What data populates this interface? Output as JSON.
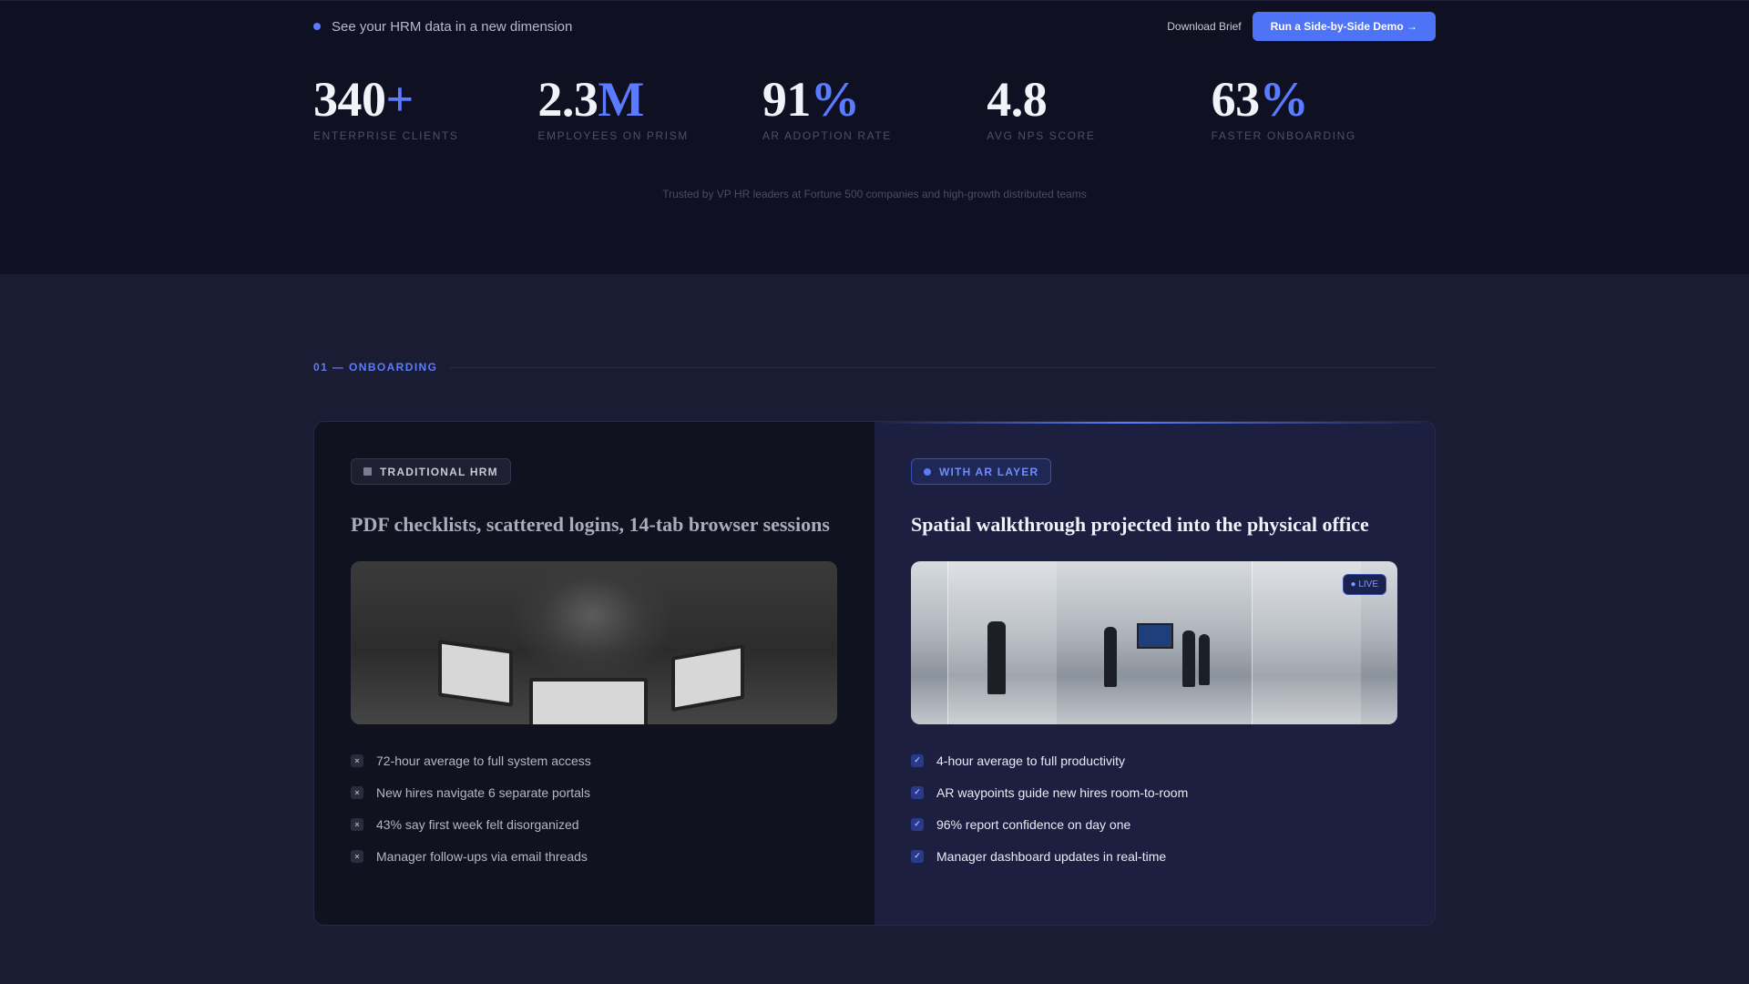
{
  "topbar": {
    "announcement": "See your HRM data in a new dimension",
    "download_label": "Download Brief",
    "demo_label": "Run a Side-by-Side Demo →"
  },
  "stats": [
    {
      "value": "340",
      "suffix": "+",
      "label": "ENTERPRISE CLIENTS"
    },
    {
      "value": "2.3",
      "suffix": "M",
      "label": "EMPLOYEES ON PRISM"
    },
    {
      "value": "91",
      "suffix": "%",
      "label": "AR ADOPTION RATE"
    },
    {
      "value": "4.8",
      "suffix": "",
      "label": "AVG NPS SCORE"
    },
    {
      "value": "63",
      "suffix": "%",
      "label": "FASTER ONBOARDING"
    }
  ],
  "trusted_text": "Trusted by VP HR leaders at Fortune 500 companies and high-growth distributed teams",
  "section": {
    "eyebrow": "01 — ONBOARDING"
  },
  "traditional": {
    "badge": "TRADITIONAL HRM",
    "title": "PDF checklists, scattered logins, 14-tab browser sessions",
    "items": [
      "72-hour average to full system access",
      "New hires navigate 6 separate portals",
      "43% say first week felt disorganized",
      "Manager follow-ups via email threads"
    ],
    "mark_icon": "×"
  },
  "ar": {
    "badge": "WITH AR LAYER",
    "title": "Spatial walkthrough projected into the physical office",
    "live_label": "● LIVE",
    "items": [
      "4-hour average to full productivity",
      "AR waypoints guide new hires room-to-room",
      "96% report confidence on day one",
      "Manager dashboard updates in real-time"
    ],
    "mark_icon": "✓"
  },
  "colors": {
    "accent": "#5b7cff",
    "cta": "#4e73f7",
    "page_bg": "#1a1c33",
    "hero_bg": "#0f1022"
  }
}
